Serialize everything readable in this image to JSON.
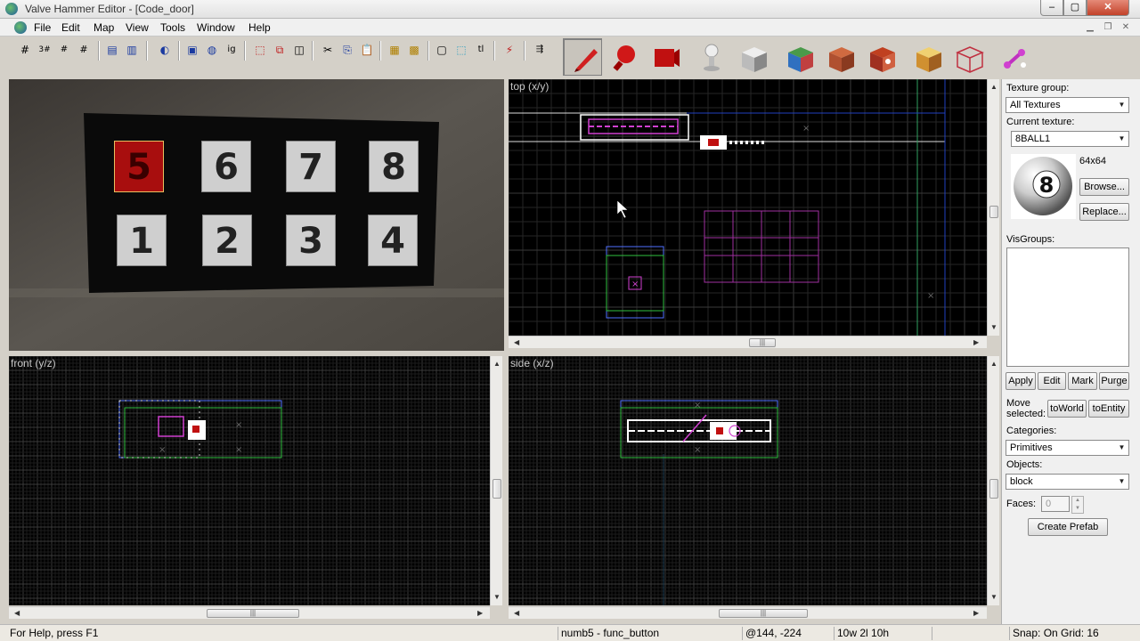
{
  "window": {
    "title": "Valve Hammer Editor - [Code_door]",
    "min": "‒",
    "max": "▢",
    "close": "✕"
  },
  "menu": {
    "items": [
      "File",
      "Edit",
      "Map",
      "View",
      "Tools",
      "Window",
      "Help"
    ]
  },
  "viewports": {
    "camera": {
      "buttons_top": [
        "5",
        "6",
        "7",
        "8"
      ],
      "buttons_bottom": [
        "1",
        "2",
        "3",
        "4"
      ]
    },
    "top": {
      "label": "top (x/y)"
    },
    "front": {
      "label": "front (y/z)"
    },
    "side": {
      "label": "side (x/z)"
    }
  },
  "panel": {
    "texture_group_label": "Texture group:",
    "texture_group_value": "All Textures",
    "current_texture_label": "Current texture:",
    "current_texture_value": "8BALL1",
    "texture_size": "64x64",
    "texture_ball_number": "8",
    "browse": "Browse...",
    "replace": "Replace...",
    "visgroups_label": "VisGroups:",
    "apply": "Apply",
    "edit": "Edit",
    "mark": "Mark",
    "purge": "Purge",
    "move_selected_line1": "Move",
    "move_selected_line2": "selected:",
    "to_world": "toWorld",
    "to_entity": "toEntity",
    "categories_label": "Categories:",
    "categories_value": "Primitives",
    "objects_label": "Objects:",
    "objects_value": "block",
    "faces_label": "Faces:",
    "faces_value": "0",
    "create_prefab": "Create Prefab"
  },
  "status": {
    "help": "For Help, press F1",
    "selection": "numb5 - func_button",
    "coords": "@144, -224",
    "size": "10w 2l 10h",
    "snap": "Snap: On Grid: 16"
  },
  "colors": {
    "selected_red": "#b01010",
    "grid_line": "#2a2a2a",
    "selection_magenta": "#d040d0",
    "brush_green": "#30c040"
  }
}
